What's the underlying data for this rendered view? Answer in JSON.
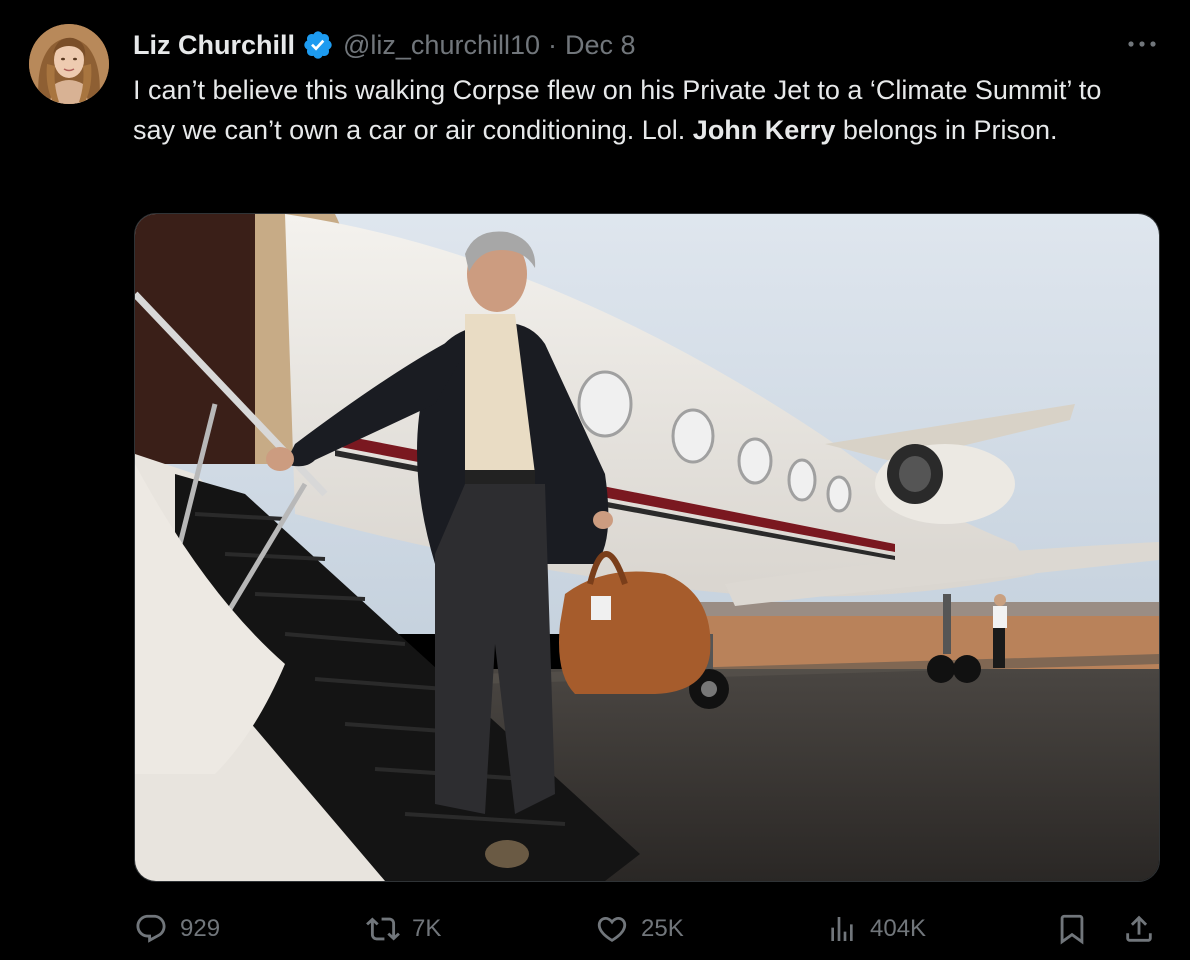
{
  "tweet": {
    "author": {
      "display_name": "Liz Churchill",
      "handle": "@liz_churchill10",
      "verified": true
    },
    "separator": "·",
    "date": "Dec 8",
    "text": {
      "part1": "I can’t believe this walking Corpse flew on his Private Jet to a ‘Climate Summit’ to say we can’t own a car or air conditioning. Lol. ",
      "bold": "John Kerry",
      "part2": " belongs in Prison."
    },
    "media": {
      "type": "photo"
    },
    "actions": {
      "replies": "929",
      "reposts": "7K",
      "likes": "25K",
      "views": "404K"
    }
  },
  "icons": {
    "avatar": "avatar-photo",
    "verified": "verified-badge-icon",
    "more": "more-dots-icon",
    "reply": "reply-bubble-icon",
    "repost": "repost-arrows-icon",
    "like": "heart-icon",
    "views": "analytics-bars-icon",
    "bookmark": "bookmark-icon",
    "share": "share-upload-icon"
  },
  "colors": {
    "background": "#000000",
    "text_primary": "#e7e9ea",
    "text_secondary": "#71767b",
    "verified_blue": "#1d9bf0",
    "border": "#2f3336"
  }
}
